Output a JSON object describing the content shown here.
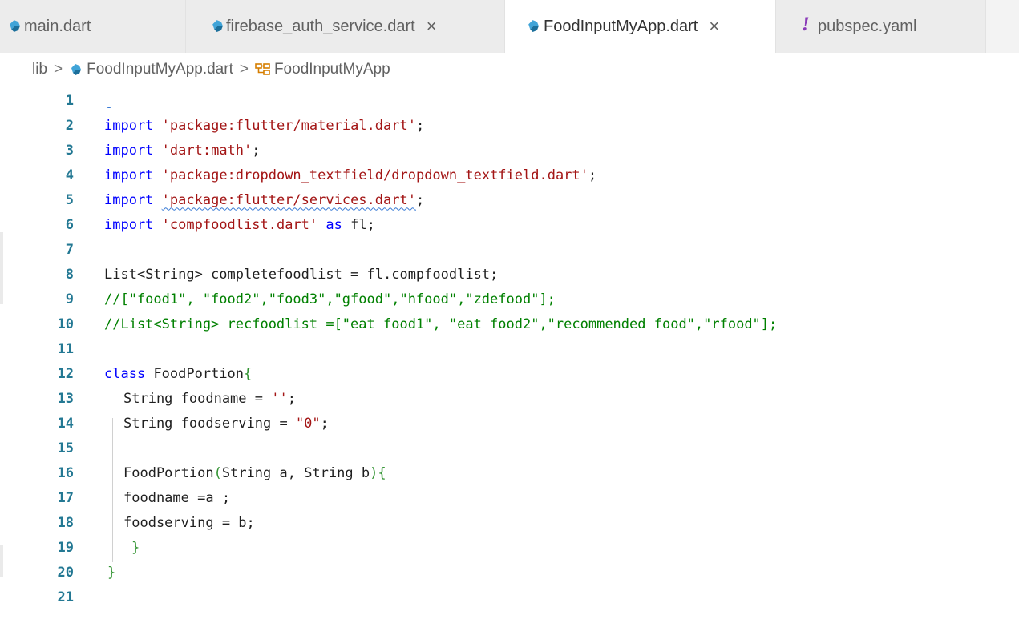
{
  "tabs": [
    {
      "label": "main.dart",
      "icon": "dart-file-icon",
      "active": false,
      "closable": false
    },
    {
      "label": "firebase_auth_service.dart",
      "icon": "dart-file-icon",
      "active": false,
      "closable": true
    },
    {
      "label": "FoodInputMyApp.dart",
      "icon": "dart-file-icon",
      "active": true,
      "closable": true
    },
    {
      "label": "pubspec.yaml",
      "icon": "yaml-file-icon",
      "active": false,
      "closable": false
    }
  ],
  "close_glyph": "×",
  "breadcrumb": {
    "folder": "lib",
    "separator": ">",
    "file": "FoodInputMyApp.dart",
    "symbol": "FoodInputMyApp"
  },
  "colors": {
    "keyword": "#0000ff",
    "string": "#a31515",
    "comment": "#008000",
    "line_number": "#237893",
    "active_tab": "#ffffff",
    "inactive_tab": "#ececec"
  },
  "editor": {
    "line_numbers": [
      "1",
      "2",
      "3",
      "4",
      "5",
      "6",
      "7",
      "8",
      "9",
      "10",
      "11",
      "12",
      "13",
      "14",
      "15",
      "16",
      "17",
      "18",
      "19",
      "20",
      "21"
    ],
    "tokens": {
      "l2_kw": "import",
      "l2_str": "'package:flutter/material.dart'",
      "l2_end": ";",
      "l3_kw": "import",
      "l3_str": "'dart:math'",
      "l3_end": ";",
      "l4_kw": "import",
      "l4_str": "'package:dropdown_textfield/dropdown_textfield.dart'",
      "l4_end": ";",
      "l5_kw": "import",
      "l5_str": "'package:flutter/services.dart'",
      "l5_end": ";",
      "l6_kw": "import",
      "l6_str": "'compfoodlist.dart'",
      "l6_as": "as",
      "l6_end": "fl;",
      "l8": "List<String> completefoodlist = fl.compfoodlist;",
      "l9": "//[\"food1\", \"food2\",\"food3\",\"gfood\",\"hfood\",\"zdefood\"];",
      "l10": "//List<String> recfoodlist =[\"eat food1\", \"eat food2\",\"recommended food\",\"rfood\"];",
      "l12_kw": "class",
      "l12_name": "FoodPortion",
      "l12_brace": "{",
      "l13_a": "String foodname = ",
      "l13_str": "''",
      "l13_end": ";",
      "l14_a": "String foodserving = ",
      "l14_str": "\"0\"",
      "l14_end": ";",
      "l16_a": "FoodPortion",
      "l16_p1": "(",
      "l16_b": "String a, String b",
      "l16_p2": ")",
      "l16_brace": "{",
      "l17": "foodname =a ;",
      "l18": "foodserving = b;",
      "l19": "}",
      "l20": "}"
    }
  }
}
